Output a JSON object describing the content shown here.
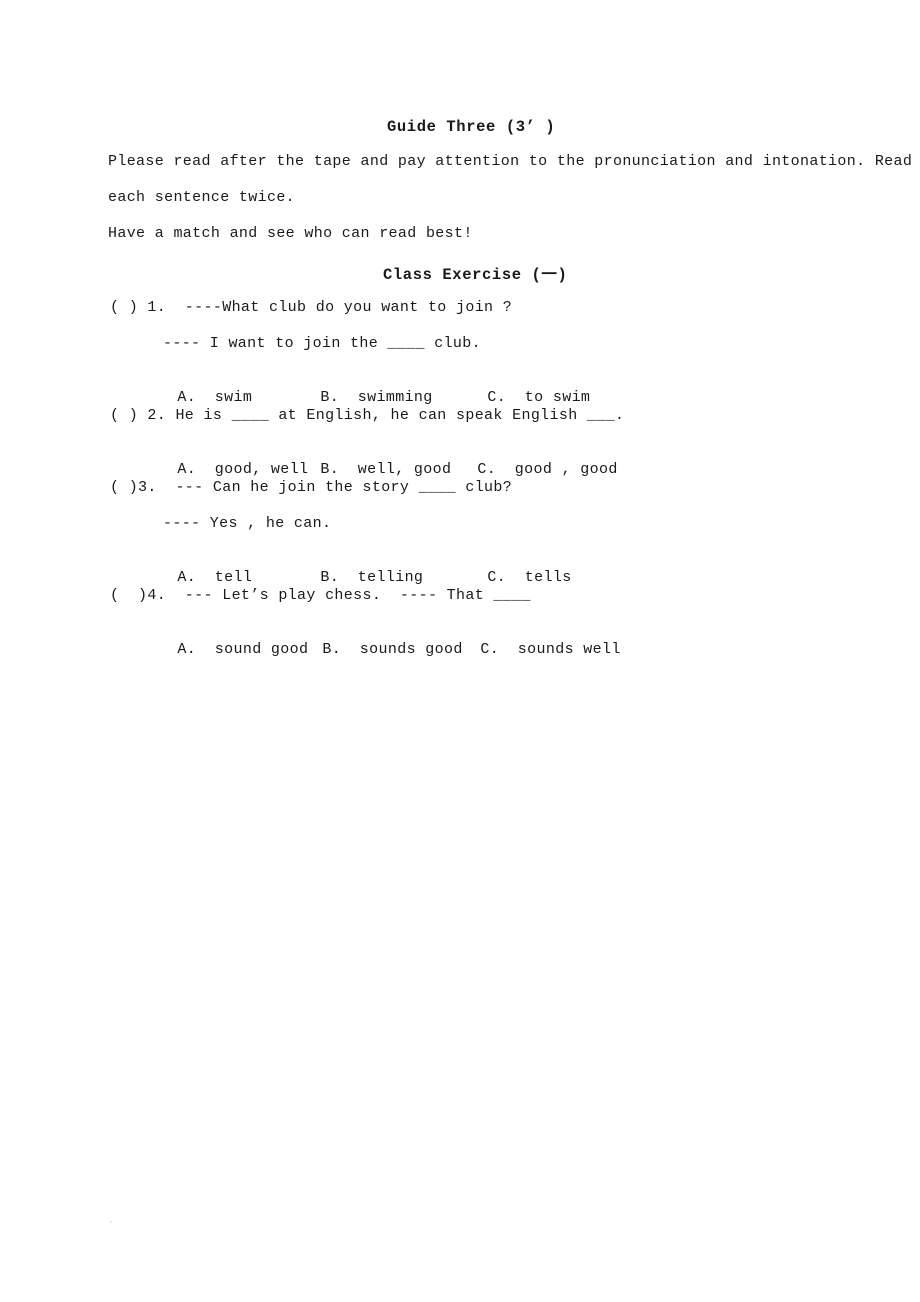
{
  "document": {
    "guide_title": "Guide Three (3’ )",
    "exercise_title": "Class Exercise (一)",
    "intro_line_1": "Please read after the tape and pay attention to the pronunciation and intonation. Read",
    "intro_line_2": "each sentence twice.",
    "match_line": "Have a match and see who can read best!"
  },
  "questions": [
    {
      "stem": "( ) 1.  ----What club do you want to join ?",
      "continuation": "---- I want to join the ____ club.",
      "options": [
        "A.  swim",
        "B.  swimming",
        "C.  to swim"
      ]
    },
    {
      "stem": "( ) 2. He is ____ at English, he can speak English ___.",
      "continuation": "",
      "options": [
        "A.  good, well",
        "B.  well, good",
        "C.  good , good"
      ]
    },
    {
      "stem": "( )3.  --- Can he join the story ____ club?",
      "continuation": "---- Yes , he can.",
      "options": [
        "A.  tell",
        "B.  telling",
        "C.  tells"
      ]
    },
    {
      "stem": "(  )4.  --- Let’s play chess.  ---- That ____",
      "continuation": "",
      "options": [
        "A.  sound good",
        "B.  sounds good",
        "C.  sounds well"
      ]
    }
  ]
}
